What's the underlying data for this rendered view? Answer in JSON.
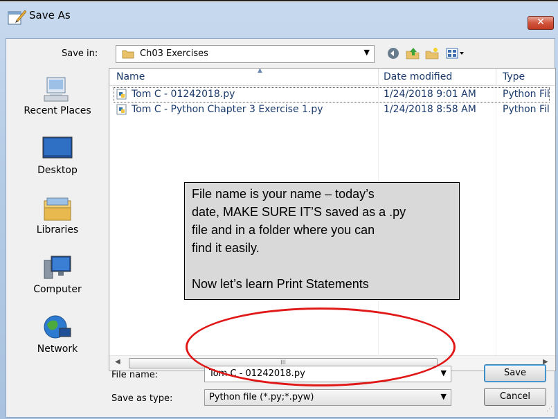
{
  "window": {
    "title": "Save As",
    "close_glyph": "✕"
  },
  "toolbar": {
    "save_in_label": "Save in:",
    "current_folder": "Ch03 Exercises",
    "icons": [
      "back-icon",
      "up-folder-icon",
      "new-folder-icon",
      "views-menu-icon"
    ]
  },
  "places": [
    {
      "label": "Recent Places",
      "icon": "recent-places-icon"
    },
    {
      "label": "Desktop",
      "icon": "desktop-icon"
    },
    {
      "label": "Libraries",
      "icon": "libraries-icon"
    },
    {
      "label": "Computer",
      "icon": "computer-icon"
    },
    {
      "label": "Network",
      "icon": "network-icon"
    }
  ],
  "file_list": {
    "columns": [
      "Name",
      "Date modified",
      "Type"
    ],
    "rows": [
      {
        "name": "Tom C - 01242018.py",
        "date": "1/24/2018 9:01 AM",
        "type": "Python Fil",
        "selected": true
      },
      {
        "name": "Tom C - Python Chapter 3 Exercise 1.py",
        "date": "1/24/2018 8:58 AM",
        "type": "Python Fil",
        "selected": false
      }
    ]
  },
  "annotation": {
    "lines": [
      "File name is your name – today’s",
      "date, MAKE SURE IT’S saved as a .py",
      "file and in a folder where you can",
      "find it easily.",
      "Now let’s learn Print Statements"
    ],
    "highlight_color": "#e01818"
  },
  "form": {
    "file_name_label": "File name:",
    "file_name_value": "Tom C - 01242018.py",
    "save_type_label": "Save as type:",
    "save_type_value": "Python file (*.py;*.pyw)"
  },
  "buttons": {
    "save": "Save",
    "cancel": "Cancel"
  },
  "scrollbar": {
    "grip_glyph": "III"
  },
  "colors": {
    "title_bar": "#b5cce6",
    "close_button": "#c13a22",
    "file_text": "#1a3a6b"
  }
}
